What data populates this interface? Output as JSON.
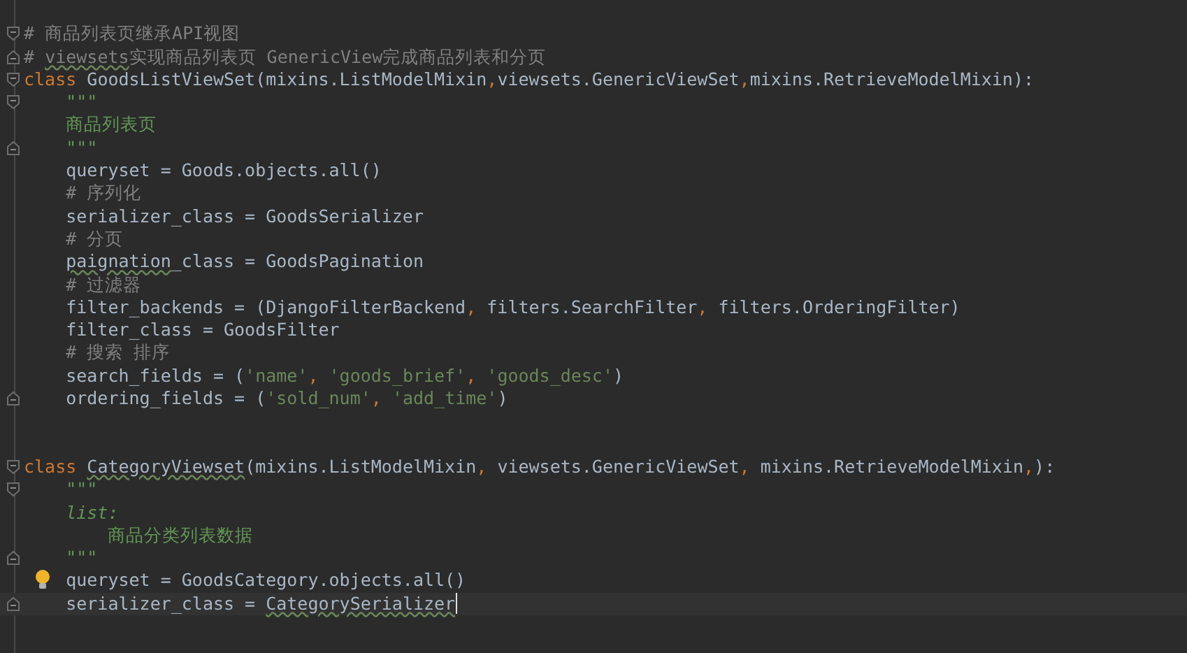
{
  "editor": {
    "lines": [
      {
        "fold_start": false,
        "fold_end": false,
        "current": false,
        "bulb": false
      },
      {
        "fold_start": true,
        "fold_end": false,
        "current": false,
        "bulb": false,
        "tokens": [
          {
            "text": "# 商品列表页继承API视图",
            "kind": "comment"
          }
        ]
      },
      {
        "fold_start": false,
        "fold_end": true,
        "current": false,
        "bulb": false,
        "tokens": [
          {
            "text": "# ",
            "kind": "comment"
          },
          {
            "text": "viewsets",
            "kind": "typo_comment"
          },
          {
            "text": "实现商品列表页 GenericView完成商品列表和分页",
            "kind": "comment"
          }
        ]
      },
      {
        "fold_start": true,
        "fold_end": false,
        "current": false,
        "bulb": false,
        "tokens": [
          {
            "text": "class",
            "kind": "keyword"
          },
          {
            "text": " GoodsListViewSet(mixins.ListModelMixin",
            "kind": "plain"
          },
          {
            "text": ",",
            "kind": "comma"
          },
          {
            "text": "viewsets.GenericViewSet",
            "kind": "plain"
          },
          {
            "text": ",",
            "kind": "comma"
          },
          {
            "text": "mixins.RetrieveModelMixin):",
            "kind": "plain"
          }
        ]
      },
      {
        "fold_start": true,
        "fold_end": false,
        "current": false,
        "bulb": false,
        "tokens": [
          {
            "text": "    \"\"\"",
            "kind": "doc"
          }
        ]
      },
      {
        "fold_start": false,
        "fold_end": false,
        "current": false,
        "bulb": false,
        "tokens": [
          {
            "text": "    商品列表页",
            "kind": "doc"
          }
        ]
      },
      {
        "fold_start": false,
        "fold_end": true,
        "current": false,
        "bulb": false,
        "tokens": [
          {
            "text": "    \"\"\"",
            "kind": "doc"
          }
        ]
      },
      {
        "fold_start": false,
        "fold_end": false,
        "current": false,
        "bulb": false,
        "tokens": [
          {
            "text": "    queryset = Goods.objects.all()",
            "kind": "plain"
          }
        ]
      },
      {
        "fold_start": false,
        "fold_end": false,
        "current": false,
        "bulb": false,
        "tokens": [
          {
            "text": "    # 序列化",
            "kind": "comment"
          }
        ]
      },
      {
        "fold_start": false,
        "fold_end": false,
        "current": false,
        "bulb": false,
        "tokens": [
          {
            "text": "    serializer_class = GoodsSerializer",
            "kind": "plain"
          }
        ]
      },
      {
        "fold_start": false,
        "fold_end": false,
        "current": false,
        "bulb": false,
        "tokens": [
          {
            "text": "    # 分页",
            "kind": "comment"
          }
        ]
      },
      {
        "fold_start": false,
        "fold_end": false,
        "current": false,
        "bulb": false,
        "tokens": [
          {
            "text": "    paignation",
            "kind": "typo"
          },
          {
            "text": "_class = GoodsPagination",
            "kind": "plain"
          }
        ]
      },
      {
        "fold_start": false,
        "fold_end": false,
        "current": false,
        "bulb": false,
        "tokens": [
          {
            "text": "    # 过滤器",
            "kind": "comment"
          }
        ]
      },
      {
        "fold_start": false,
        "fold_end": false,
        "current": false,
        "bulb": false,
        "tokens": [
          {
            "text": "    filter_backends = (DjangoFilterBackend",
            "kind": "plain"
          },
          {
            "text": ", ",
            "kind": "comma"
          },
          {
            "text": "filters.SearchFilter",
            "kind": "plain"
          },
          {
            "text": ", ",
            "kind": "comma"
          },
          {
            "text": "filters.OrderingFilter)",
            "kind": "plain"
          }
        ]
      },
      {
        "fold_start": false,
        "fold_end": false,
        "current": false,
        "bulb": false,
        "tokens": [
          {
            "text": "    filter_class = GoodsFilter",
            "kind": "plain"
          }
        ]
      },
      {
        "fold_start": false,
        "fold_end": false,
        "current": false,
        "bulb": false,
        "tokens": [
          {
            "text": "    # 搜索 排序",
            "kind": "comment"
          }
        ]
      },
      {
        "fold_start": false,
        "fold_end": false,
        "current": false,
        "bulb": false,
        "tokens": [
          {
            "text": "    search_fields = (",
            "kind": "plain"
          },
          {
            "text": "'name'",
            "kind": "string"
          },
          {
            "text": ", ",
            "kind": "comma"
          },
          {
            "text": "'goods_brief'",
            "kind": "string"
          },
          {
            "text": ", ",
            "kind": "comma"
          },
          {
            "text": "'goods_desc'",
            "kind": "string"
          },
          {
            "text": ")",
            "kind": "plain"
          }
        ]
      },
      {
        "fold_start": false,
        "fold_end": true,
        "current": false,
        "bulb": false,
        "tokens": [
          {
            "text": "    ordering_fields = (",
            "kind": "plain"
          },
          {
            "text": "'sold_num'",
            "kind": "string"
          },
          {
            "text": ", ",
            "kind": "comma"
          },
          {
            "text": "'add_time'",
            "kind": "string"
          },
          {
            "text": ")",
            "kind": "plain"
          }
        ]
      },
      {
        "fold_start": false,
        "fold_end": false,
        "current": false,
        "bulb": false
      },
      {
        "fold_start": false,
        "fold_end": false,
        "current": false,
        "bulb": false
      },
      {
        "fold_start": true,
        "fold_end": false,
        "current": false,
        "bulb": false,
        "tokens": [
          {
            "text": "class",
            "kind": "keyword"
          },
          {
            "text": " CategoryViewset",
            "kind": "typo"
          },
          {
            "text": "(mixins.ListModelMixin",
            "kind": "plain"
          },
          {
            "text": ", ",
            "kind": "comma"
          },
          {
            "text": "viewsets.GenericViewSet",
            "kind": "plain"
          },
          {
            "text": ", ",
            "kind": "comma"
          },
          {
            "text": "mixins.RetrieveModelMixin",
            "kind": "plain"
          },
          {
            "text": ",",
            "kind": "comma"
          },
          {
            "text": "):",
            "kind": "plain"
          }
        ]
      },
      {
        "fold_start": true,
        "fold_end": false,
        "current": false,
        "bulb": false,
        "tokens": [
          {
            "text": "    \"\"\"",
            "kind": "doc"
          }
        ]
      },
      {
        "fold_start": false,
        "fold_end": false,
        "current": false,
        "bulb": false,
        "tokens": [
          {
            "text": "    list:",
            "kind": "doc_italic"
          }
        ]
      },
      {
        "fold_start": false,
        "fold_end": false,
        "current": false,
        "bulb": false,
        "tokens": [
          {
            "text": "        商品分类列表数据",
            "kind": "doc"
          }
        ]
      },
      {
        "fold_start": false,
        "fold_end": true,
        "current": false,
        "bulb": false,
        "tokens": [
          {
            "text": "    \"\"\"",
            "kind": "doc"
          }
        ]
      },
      {
        "fold_start": false,
        "fold_end": false,
        "current": false,
        "bulb": true,
        "tokens": [
          {
            "text": "    queryset = GoodsCategory.objects.all()",
            "kind": "plain"
          }
        ]
      },
      {
        "fold_start": false,
        "fold_end": true,
        "current": true,
        "bulb": false,
        "tokens": [
          {
            "text": "    serializer_class = ",
            "kind": "plain"
          },
          {
            "text": "CategorySerializer",
            "kind": "typo"
          }
        ]
      }
    ]
  }
}
